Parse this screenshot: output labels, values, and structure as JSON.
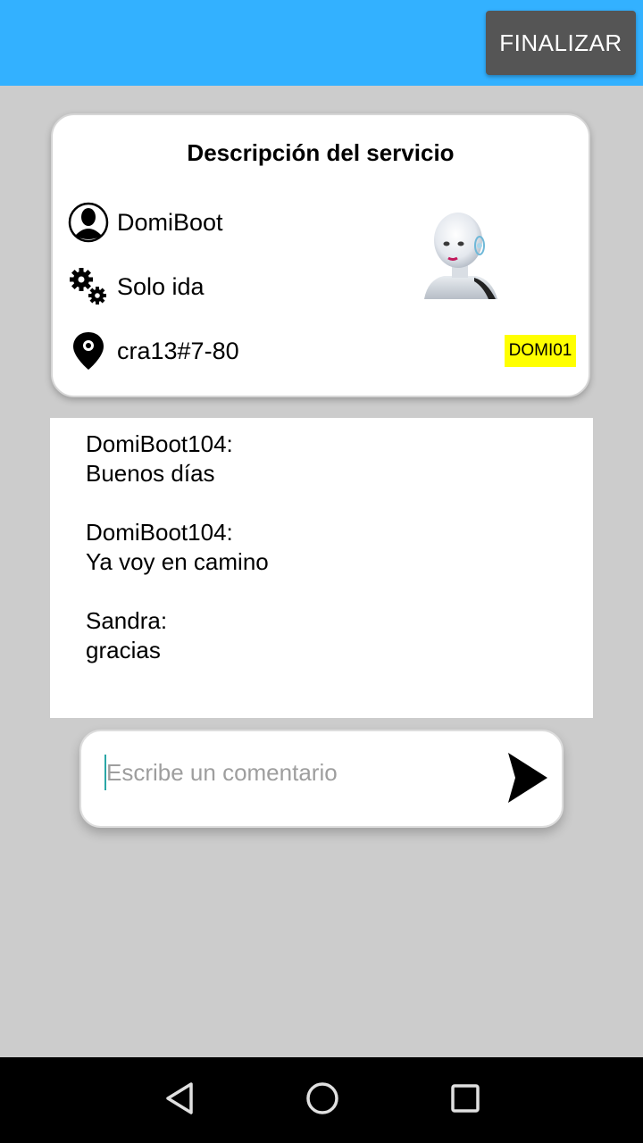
{
  "appbar": {
    "finalize_label": "FINALIZAR",
    "color": "#33b1ff"
  },
  "service_card": {
    "title": "Descripción del servicio",
    "user_name": "DomiBoot",
    "service_type": "Solo ida",
    "address": "cra13#7-80",
    "code": "DOMI01",
    "code_color": "#ffff00",
    "icons": [
      "person-icon",
      "gears-icon",
      "location-pin-icon"
    ],
    "avatar": "robot-avatar"
  },
  "chat": {
    "messages": [
      {
        "author": "DomiBoot104:",
        "text": "Buenos días"
      },
      {
        "author": "DomiBoot104:",
        "text": "Ya voy en camino"
      },
      {
        "author": "Sandra:",
        "text": "gracias"
      }
    ]
  },
  "comment": {
    "placeholder": "Escribe un comentario",
    "value": "",
    "send_icon": "send-icon"
  },
  "navbar": {
    "icons": [
      "back-icon",
      "home-icon",
      "recents-icon"
    ]
  }
}
